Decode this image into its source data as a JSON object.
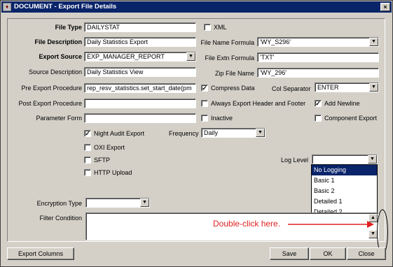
{
  "window": {
    "title": "DOCUMENT - Export File Details",
    "close_glyph": "×"
  },
  "form": {
    "file_type": {
      "label": "File Type",
      "value": "DAILYSTAT"
    },
    "xml": {
      "label": "XML",
      "checked": false
    },
    "file_description": {
      "label": "File Description",
      "value": "Daily Statistics Export"
    },
    "file_name_formula": {
      "label": "File Name Formula",
      "value": "'WY_S296'"
    },
    "export_source": {
      "label": "Export Source",
      "value": "EXP_MANAGER_REPORT"
    },
    "file_extn_formula": {
      "label": "File Extn Formula",
      "value": "'TXT'"
    },
    "source_description": {
      "label": "Source Description",
      "value": "Daily Statistics View"
    },
    "zip_file_name": {
      "label": "Zip File Name",
      "value": "'WY_296'"
    },
    "pre_export_procedure": {
      "label": "Pre Export Procedure",
      "value": "rep_resv_statistics.set_start_date(pm"
    },
    "compress_data": {
      "label": "Compress Data",
      "checked": true
    },
    "col_separator": {
      "label": "Col Separator",
      "value": "ENTER"
    },
    "post_export_procedure": {
      "label": "Post Export Procedure",
      "value": ""
    },
    "always_export_header": {
      "label": "Always Export Header and Footer",
      "checked": false
    },
    "add_newline": {
      "label": "Add Newline",
      "checked": true
    },
    "parameter_form": {
      "label": "Parameter Form",
      "value": ""
    },
    "inactive": {
      "label": "Inactive",
      "checked": false
    },
    "component_export": {
      "label": "Component Export",
      "checked": false
    },
    "night_audit_export": {
      "label": "Night Audit Export",
      "checked": true
    },
    "frequency": {
      "label": "Frequency",
      "value": "Daily"
    },
    "oxi_export": {
      "label": "OXI Export",
      "checked": false
    },
    "sftp": {
      "label": "SFTP",
      "checked": false
    },
    "http_upload": {
      "label": "HTTP Upload",
      "checked": false
    },
    "log_level": {
      "label": "Log Level",
      "value": "",
      "options": [
        "No Logging",
        "Basic 1",
        "Basic 2",
        "Detailed 1",
        "Detailed 2"
      ],
      "highlighted": "No Logging"
    },
    "encryption_type": {
      "label": "Encryption Type",
      "value": ""
    },
    "filter_condition": {
      "label": "Filter Condition",
      "value": ""
    }
  },
  "annotation": {
    "text": "Double-click here.",
    "color": "#e02020"
  },
  "buttons": {
    "export_columns": "Export Columns",
    "save": "Save",
    "ok": "OK",
    "close": "Close"
  },
  "icons": {
    "dropdown": "arrow-down-underline-icon",
    "check": "checkmark-icon"
  },
  "colors": {
    "titlebar": "#0a246a",
    "window": "#d4d0c8",
    "selection": "#0a246a"
  }
}
